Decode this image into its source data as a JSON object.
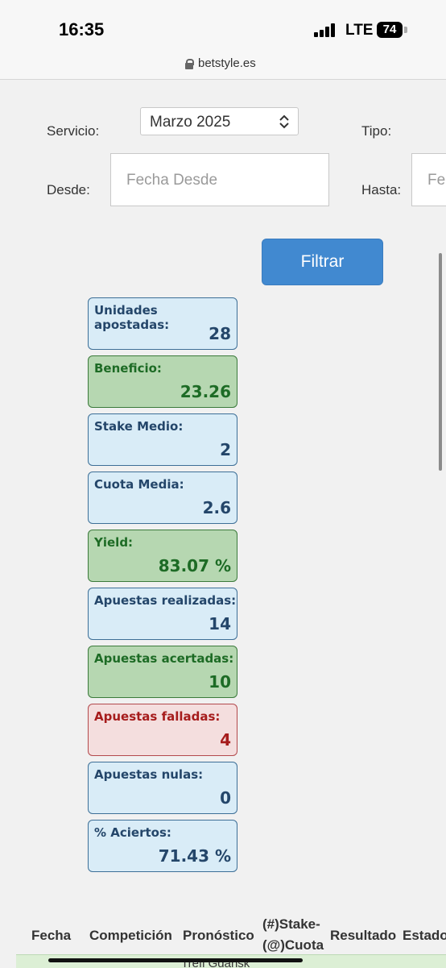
{
  "status_bar": {
    "time": "16:35",
    "network": "LTE",
    "battery": "74"
  },
  "browser": {
    "url": "betstyle.es"
  },
  "filters": {
    "servicio_label": "Servicio:",
    "servicio_value": "Marzo 2025",
    "tipo_label": "Tipo:",
    "desde_label": "Desde:",
    "desde_placeholder": "Fecha Desde",
    "hasta_label": "Hasta:",
    "hasta_placeholder": "Fecha Hasta",
    "filter_button": "Filtrar"
  },
  "stats": [
    {
      "label": "Unidades apostadas:",
      "value": "28",
      "variant": "info"
    },
    {
      "label": "Beneficio:",
      "value": "23.26",
      "variant": "success"
    },
    {
      "label": "Stake Medio:",
      "value": "2",
      "variant": "info"
    },
    {
      "label": "Cuota Media:",
      "value": "2.6",
      "variant": "info"
    },
    {
      "label": "Yield:",
      "value": "83.07 %",
      "variant": "success"
    },
    {
      "label": "Apuestas realizadas:",
      "value": "14",
      "variant": "info"
    },
    {
      "label": "Apuestas acertadas:",
      "value": "10",
      "variant": "success"
    },
    {
      "label": "Apuestas falladas:",
      "value": "4",
      "variant": "danger"
    },
    {
      "label": "Apuestas nulas:",
      "value": "0",
      "variant": "info"
    },
    {
      "label": "% Aciertos:",
      "value": "71.43 %",
      "variant": "info"
    }
  ],
  "table": {
    "headers": [
      "Fecha",
      "Competición",
      "Pronóstico",
      "(#)Stake-",
      "(@)Cuota",
      "Resultado",
      "Estado"
    ],
    "first_row_partial": "Trefl Gdansk"
  }
}
